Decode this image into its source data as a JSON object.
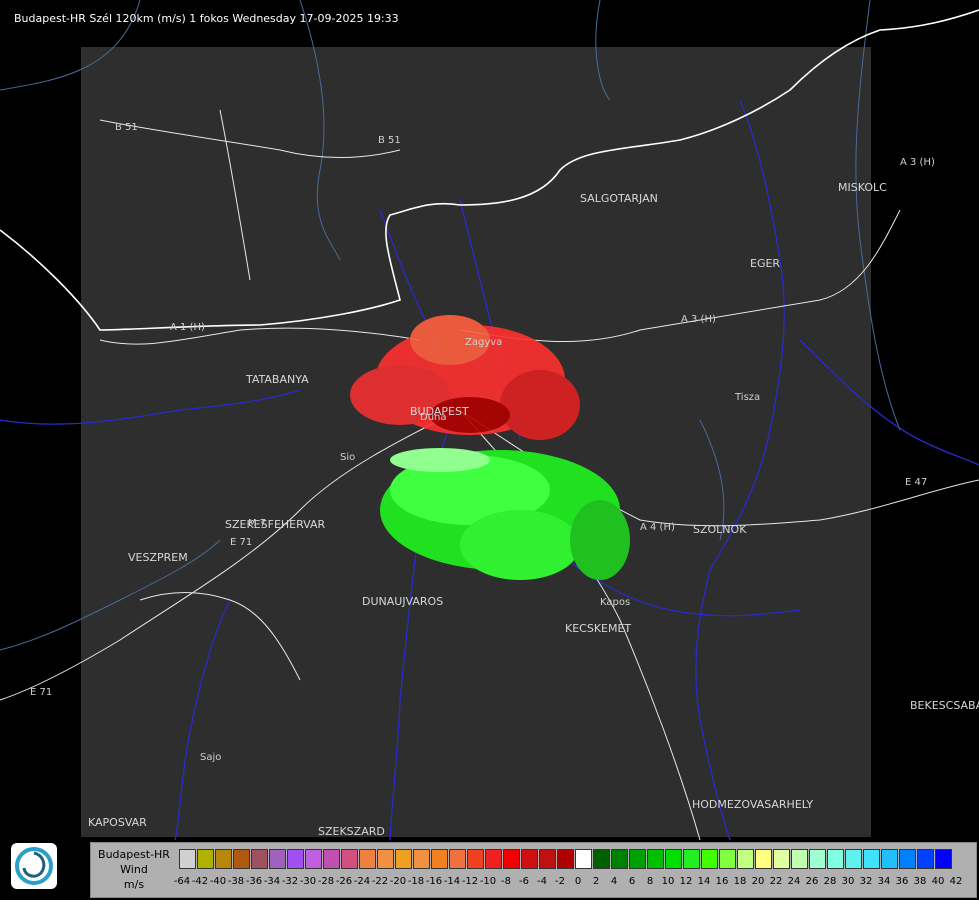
{
  "header": {
    "title": "Budapest-HR Szél 120km (m/s) 1 fokos Wednesday 17-09-2025 19:33"
  },
  "map": {
    "places": [
      "SALGOTARJAN",
      "MISKOLC",
      "EGER",
      "TATABANYA",
      "BUDAPEST",
      "SZEKESFEHERVAR",
      "VESZPREM",
      "DUNAUJVAROS",
      "KECSKEMET",
      "SZOLNOK",
      "BEKESCSABA",
      "HODMEZOVASARHELY",
      "KAPOSVAR",
      "SZEKSZARD"
    ],
    "roads": [
      "B 51",
      "B 51",
      "A 3 (H)",
      "A 3 (H)",
      "A 1 (H)",
      "A 4 (H)",
      "E 71",
      "E 71",
      "E 47",
      "M 7"
    ],
    "rivers": [
      "Duna",
      "Tisza",
      "Zagyva",
      "Sajo",
      "Sio",
      "Kapos"
    ]
  },
  "legend": {
    "title_lines": [
      "Budapest-HR",
      "Wind",
      "m/s"
    ],
    "colors": [
      "#d0d0d0",
      "#b0b000",
      "#b8860b",
      "#b05a10",
      "#a05060",
      "#a060c0",
      "#a050f0",
      "#c060e0",
      "#c050b0",
      "#d05080",
      "#f08040",
      "#f09040",
      "#f0a020",
      "#f09040",
      "#f08020",
      "#f07040",
      "#f04020",
      "#f02020",
      "#f00000",
      "#d01010",
      "#c01010",
      "#b00000",
      "#ffffff",
      "#006000",
      "#008000",
      "#00a000",
      "#00c000",
      "#00e000",
      "#20f020",
      "#40ff00",
      "#80ff40",
      "#c0ff80",
      "#ffff80",
      "#e0ffa0",
      "#c0ffb0",
      "#a0ffd0",
      "#80ffe0",
      "#60f0f0",
      "#40e0ff",
      "#20c0ff",
      "#0080ff",
      "#0040ff",
      "#0000ff"
    ],
    "ticks": [
      "-64",
      "-42",
      "-40",
      "-38",
      "-36",
      "-34",
      "-32",
      "-30",
      "-28",
      "-26",
      "-24",
      "-22",
      "-20",
      "-18",
      "-16",
      "-14",
      "-12",
      "-10",
      "-8",
      "-6",
      "-4",
      "-2",
      "0",
      "2",
      "4",
      "6",
      "8",
      "10",
      "12",
      "14",
      "16",
      "18",
      "20",
      "22",
      "24",
      "26",
      "28",
      "30",
      "32",
      "34",
      "36",
      "38",
      "40",
      "42"
    ]
  }
}
